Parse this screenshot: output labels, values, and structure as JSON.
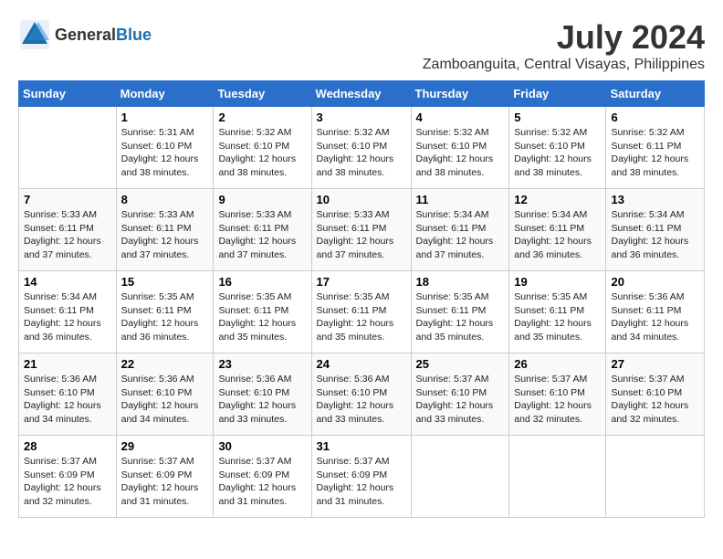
{
  "header": {
    "logo_general": "General",
    "logo_blue": "Blue",
    "month_title": "July 2024",
    "location": "Zamboanguita, Central Visayas, Philippines"
  },
  "weekdays": [
    "Sunday",
    "Monday",
    "Tuesday",
    "Wednesday",
    "Thursday",
    "Friday",
    "Saturday"
  ],
  "weeks": [
    [
      {
        "day": "",
        "sunrise": "",
        "sunset": "",
        "daylight": ""
      },
      {
        "day": "1",
        "sunrise": "Sunrise: 5:31 AM",
        "sunset": "Sunset: 6:10 PM",
        "daylight": "Daylight: 12 hours and 38 minutes."
      },
      {
        "day": "2",
        "sunrise": "Sunrise: 5:32 AM",
        "sunset": "Sunset: 6:10 PM",
        "daylight": "Daylight: 12 hours and 38 minutes."
      },
      {
        "day": "3",
        "sunrise": "Sunrise: 5:32 AM",
        "sunset": "Sunset: 6:10 PM",
        "daylight": "Daylight: 12 hours and 38 minutes."
      },
      {
        "day": "4",
        "sunrise": "Sunrise: 5:32 AM",
        "sunset": "Sunset: 6:10 PM",
        "daylight": "Daylight: 12 hours and 38 minutes."
      },
      {
        "day": "5",
        "sunrise": "Sunrise: 5:32 AM",
        "sunset": "Sunset: 6:10 PM",
        "daylight": "Daylight: 12 hours and 38 minutes."
      },
      {
        "day": "6",
        "sunrise": "Sunrise: 5:32 AM",
        "sunset": "Sunset: 6:11 PM",
        "daylight": "Daylight: 12 hours and 38 minutes."
      }
    ],
    [
      {
        "day": "7",
        "sunrise": "Sunrise: 5:33 AM",
        "sunset": "Sunset: 6:11 PM",
        "daylight": "Daylight: 12 hours and 37 minutes."
      },
      {
        "day": "8",
        "sunrise": "Sunrise: 5:33 AM",
        "sunset": "Sunset: 6:11 PM",
        "daylight": "Daylight: 12 hours and 37 minutes."
      },
      {
        "day": "9",
        "sunrise": "Sunrise: 5:33 AM",
        "sunset": "Sunset: 6:11 PM",
        "daylight": "Daylight: 12 hours and 37 minutes."
      },
      {
        "day": "10",
        "sunrise": "Sunrise: 5:33 AM",
        "sunset": "Sunset: 6:11 PM",
        "daylight": "Daylight: 12 hours and 37 minutes."
      },
      {
        "day": "11",
        "sunrise": "Sunrise: 5:34 AM",
        "sunset": "Sunset: 6:11 PM",
        "daylight": "Daylight: 12 hours and 37 minutes."
      },
      {
        "day": "12",
        "sunrise": "Sunrise: 5:34 AM",
        "sunset": "Sunset: 6:11 PM",
        "daylight": "Daylight: 12 hours and 36 minutes."
      },
      {
        "day": "13",
        "sunrise": "Sunrise: 5:34 AM",
        "sunset": "Sunset: 6:11 PM",
        "daylight": "Daylight: 12 hours and 36 minutes."
      }
    ],
    [
      {
        "day": "14",
        "sunrise": "Sunrise: 5:34 AM",
        "sunset": "Sunset: 6:11 PM",
        "daylight": "Daylight: 12 hours and 36 minutes."
      },
      {
        "day": "15",
        "sunrise": "Sunrise: 5:35 AM",
        "sunset": "Sunset: 6:11 PM",
        "daylight": "Daylight: 12 hours and 36 minutes."
      },
      {
        "day": "16",
        "sunrise": "Sunrise: 5:35 AM",
        "sunset": "Sunset: 6:11 PM",
        "daylight": "Daylight: 12 hours and 35 minutes."
      },
      {
        "day": "17",
        "sunrise": "Sunrise: 5:35 AM",
        "sunset": "Sunset: 6:11 PM",
        "daylight": "Daylight: 12 hours and 35 minutes."
      },
      {
        "day": "18",
        "sunrise": "Sunrise: 5:35 AM",
        "sunset": "Sunset: 6:11 PM",
        "daylight": "Daylight: 12 hours and 35 minutes."
      },
      {
        "day": "19",
        "sunrise": "Sunrise: 5:35 AM",
        "sunset": "Sunset: 6:11 PM",
        "daylight": "Daylight: 12 hours and 35 minutes."
      },
      {
        "day": "20",
        "sunrise": "Sunrise: 5:36 AM",
        "sunset": "Sunset: 6:11 PM",
        "daylight": "Daylight: 12 hours and 34 minutes."
      }
    ],
    [
      {
        "day": "21",
        "sunrise": "Sunrise: 5:36 AM",
        "sunset": "Sunset: 6:10 PM",
        "daylight": "Daylight: 12 hours and 34 minutes."
      },
      {
        "day": "22",
        "sunrise": "Sunrise: 5:36 AM",
        "sunset": "Sunset: 6:10 PM",
        "daylight": "Daylight: 12 hours and 34 minutes."
      },
      {
        "day": "23",
        "sunrise": "Sunrise: 5:36 AM",
        "sunset": "Sunset: 6:10 PM",
        "daylight": "Daylight: 12 hours and 33 minutes."
      },
      {
        "day": "24",
        "sunrise": "Sunrise: 5:36 AM",
        "sunset": "Sunset: 6:10 PM",
        "daylight": "Daylight: 12 hours and 33 minutes."
      },
      {
        "day": "25",
        "sunrise": "Sunrise: 5:37 AM",
        "sunset": "Sunset: 6:10 PM",
        "daylight": "Daylight: 12 hours and 33 minutes."
      },
      {
        "day": "26",
        "sunrise": "Sunrise: 5:37 AM",
        "sunset": "Sunset: 6:10 PM",
        "daylight": "Daylight: 12 hours and 32 minutes."
      },
      {
        "day": "27",
        "sunrise": "Sunrise: 5:37 AM",
        "sunset": "Sunset: 6:10 PM",
        "daylight": "Daylight: 12 hours and 32 minutes."
      }
    ],
    [
      {
        "day": "28",
        "sunrise": "Sunrise: 5:37 AM",
        "sunset": "Sunset: 6:09 PM",
        "daylight": "Daylight: 12 hours and 32 minutes."
      },
      {
        "day": "29",
        "sunrise": "Sunrise: 5:37 AM",
        "sunset": "Sunset: 6:09 PM",
        "daylight": "Daylight: 12 hours and 31 minutes."
      },
      {
        "day": "30",
        "sunrise": "Sunrise: 5:37 AM",
        "sunset": "Sunset: 6:09 PM",
        "daylight": "Daylight: 12 hours and 31 minutes."
      },
      {
        "day": "31",
        "sunrise": "Sunrise: 5:37 AM",
        "sunset": "Sunset: 6:09 PM",
        "daylight": "Daylight: 12 hours and 31 minutes."
      },
      {
        "day": "",
        "sunrise": "",
        "sunset": "",
        "daylight": ""
      },
      {
        "day": "",
        "sunrise": "",
        "sunset": "",
        "daylight": ""
      },
      {
        "day": "",
        "sunrise": "",
        "sunset": "",
        "daylight": ""
      }
    ]
  ]
}
